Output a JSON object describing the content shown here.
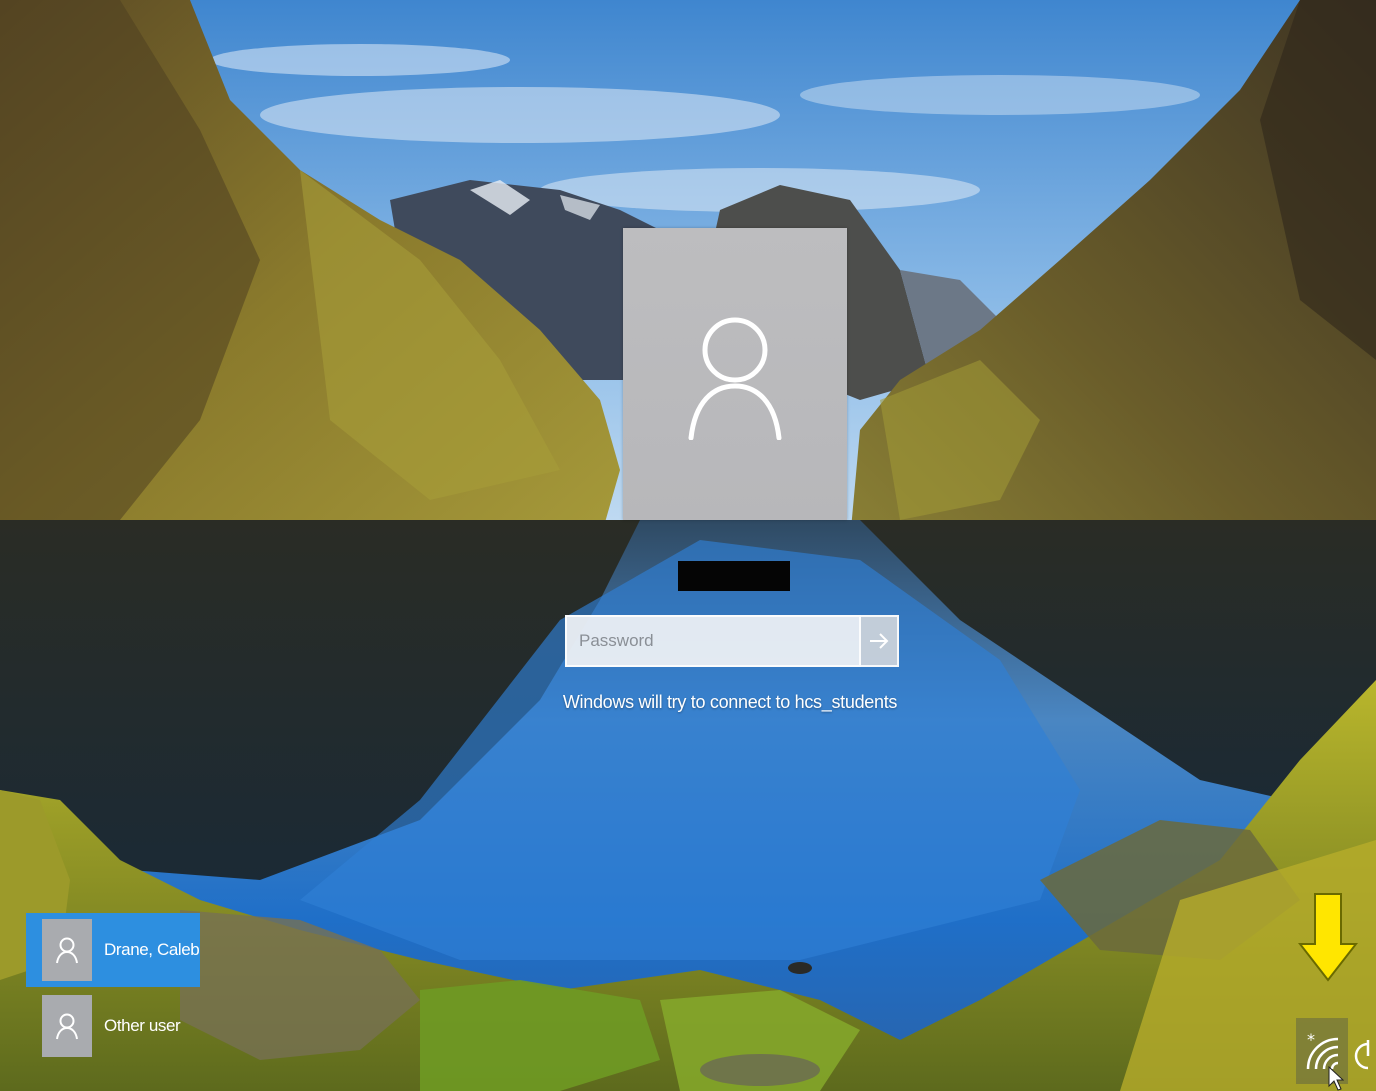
{
  "login": {
    "password_placeholder": "Password",
    "password_value": "",
    "wifi_message": "Windows will try to connect to hcs_students"
  },
  "users": [
    {
      "name": "Drane, Caleb",
      "selected": true
    },
    {
      "name": "Other user",
      "selected": false
    }
  ],
  "icons": {
    "avatar": "user-outline-icon",
    "submit": "arrow-right-icon",
    "network": "wifi-icon",
    "power": "power-icon",
    "annotation": "yellow-down-arrow-icon",
    "cursor": "mouse-pointer-icon"
  },
  "colors": {
    "selected_user_bg": "#2d8fe0",
    "annotation_arrow": "#ffe600",
    "avatar_tile": "#bdbdbf"
  }
}
